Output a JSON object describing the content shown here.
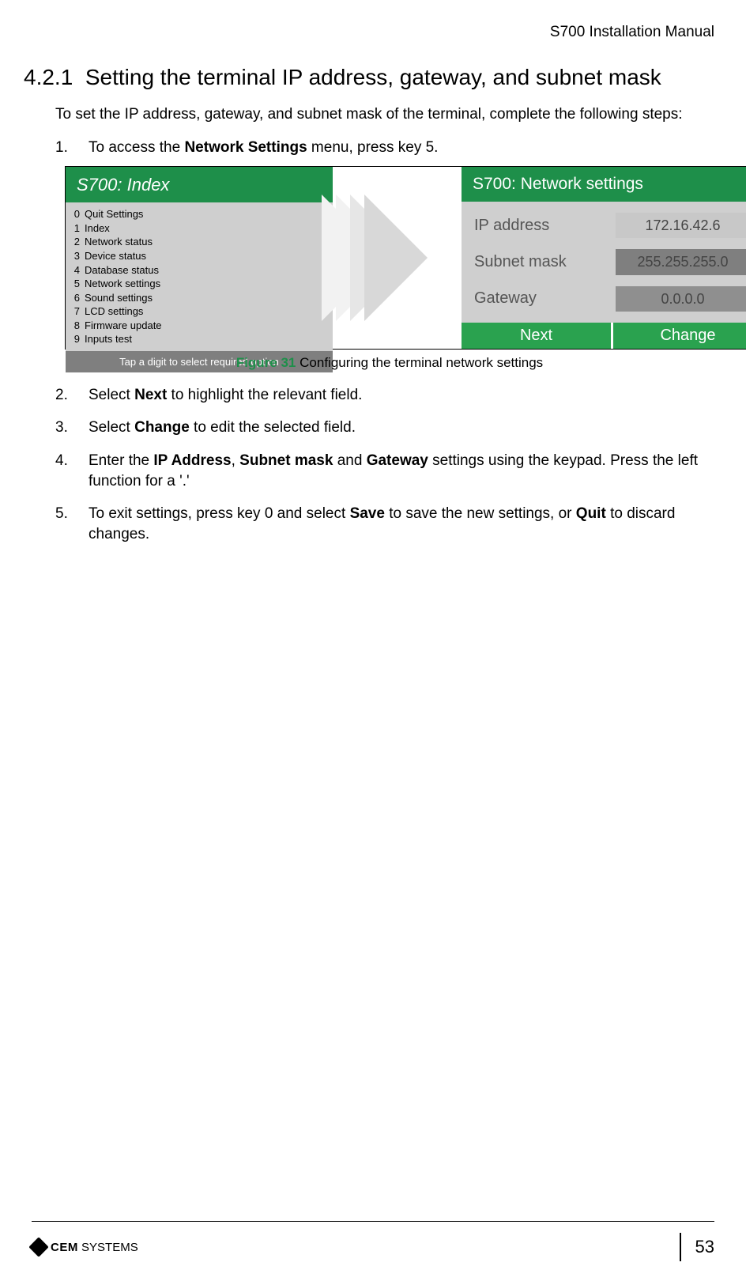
{
  "header": {
    "doc_title": "S700 Installation Manual"
  },
  "section": {
    "number": "4.2.1",
    "title": "Setting the terminal IP address, gateway, and subnet mask"
  },
  "intro": "To set the IP address, gateway, and subnet mask of the terminal, complete the following steps:",
  "steps": {
    "s1": {
      "pre": "To access the ",
      "b1": "Network Settings",
      "post": " menu, press key 5."
    },
    "s2": {
      "pre": "Select ",
      "b1": "Next",
      "post": " to highlight the relevant field."
    },
    "s3": {
      "pre": "Select ",
      "b1": "Change",
      "post": " to edit the selected field."
    },
    "s4": {
      "pre": "Enter the ",
      "b1": "IP Address",
      "mid1": ", ",
      "b2": "Subnet mask",
      "mid2": " and ",
      "b3": "Gateway",
      "post": " settings using the keypad. Press the left function for a '.'"
    },
    "s5": {
      "pre": "To exit settings, press key 0 and select ",
      "b1": "Save",
      "mid1": " to save the new settings, or ",
      "b2": "Quit",
      "post": " to discard changes."
    }
  },
  "figure": {
    "left_title": "S700: Index",
    "menu": [
      {
        "n": "0",
        "t": "Quit Settings"
      },
      {
        "n": "1",
        "t": "Index"
      },
      {
        "n": "2",
        "t": "Network status"
      },
      {
        "n": "3",
        "t": "Device status"
      },
      {
        "n": "4",
        "t": "Database status"
      },
      {
        "n": "5",
        "t": "Network settings"
      },
      {
        "n": "6",
        "t": "Sound settings"
      },
      {
        "n": "7",
        "t": "LCD settings"
      },
      {
        "n": "8",
        "t": "Firmware update"
      },
      {
        "n": "9",
        "t": "Inputs test"
      }
    ],
    "left_foot": "Tap a digit to select required option",
    "right_title": "S700: Network settings",
    "fields": {
      "ip_label": "IP address",
      "ip_value": "172.16.42.6",
      "subnet_label": "Subnet mask",
      "subnet_value": "255.255.255.0",
      "gw_label": "Gateway",
      "gw_value": "0.0.0.0"
    },
    "btn_next": "Next",
    "btn_change": "Change",
    "caption_num": "Figure 31",
    "caption_text": " Configuring the terminal network settings"
  },
  "footer": {
    "logo_bold": "CEM",
    "logo_rest": " SYSTEMS",
    "page": "53"
  }
}
